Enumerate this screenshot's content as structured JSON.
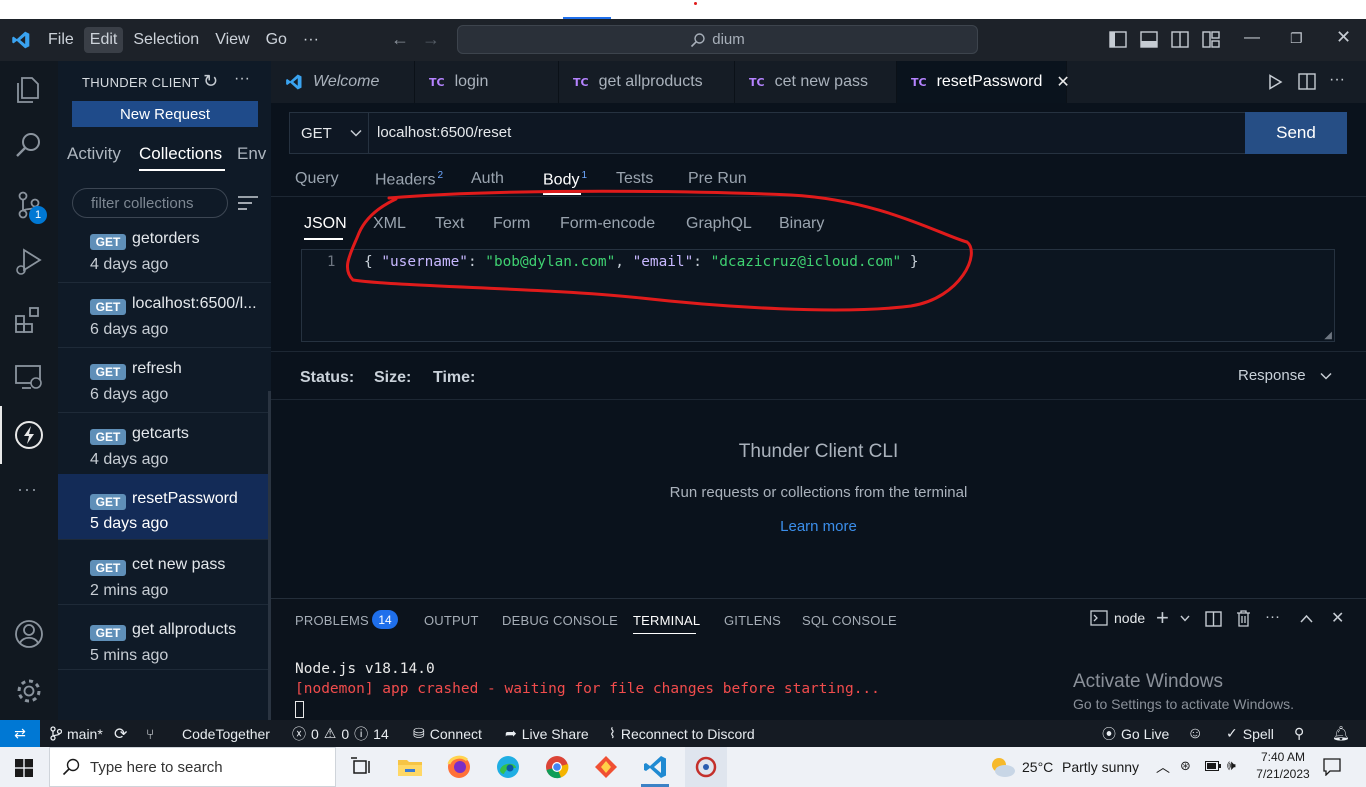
{
  "titlebar": {
    "menu": [
      "File",
      "Edit",
      "Selection",
      "View",
      "Go",
      "···"
    ],
    "active_menu": "Edit",
    "search_text": "dium"
  },
  "activity_bar": {
    "source_control_badge": "1"
  },
  "sidebar": {
    "title": "THUNDER CLIENT",
    "new_request": "New Request",
    "tabs": [
      "Activity",
      "Collections",
      "Env"
    ],
    "active_tab": "Collections",
    "filter_placeholder": "filter collections",
    "items": [
      {
        "method": "GET",
        "name": "getorders",
        "time": "4 days ago"
      },
      {
        "method": "GET",
        "name": "localhost:6500/l...",
        "time": "6 days ago"
      },
      {
        "method": "GET",
        "name": "refresh",
        "time": "6 days ago"
      },
      {
        "method": "GET",
        "name": "getcarts",
        "time": "4 days ago"
      },
      {
        "method": "GET",
        "name": "resetPassword",
        "time": "5 days ago"
      },
      {
        "method": "GET",
        "name": "cet new pass",
        "time": "2 mins ago"
      },
      {
        "method": "GET",
        "name": "get allproducts",
        "time": "5 mins ago"
      }
    ]
  },
  "tabs": [
    {
      "label": "Welcome",
      "kind": "vscode"
    },
    {
      "label": "login",
      "kind": "TC"
    },
    {
      "label": "get allproducts",
      "kind": "TC"
    },
    {
      "label": "cet new pass",
      "kind": "TC"
    },
    {
      "label": "resetPassword",
      "kind": "TC"
    }
  ],
  "request": {
    "method": "GET",
    "url": "localhost:6500/reset",
    "send_label": "Send",
    "tabs": [
      "Query",
      "Headers",
      "Auth",
      "Body",
      "Tests",
      "Pre Run"
    ],
    "headers_count": "2",
    "body_count": "1",
    "body_types": [
      "JSON",
      "XML",
      "Text",
      "Form",
      "Form-encode",
      "GraphQL",
      "Binary"
    ],
    "line_number": "1",
    "body_code": {
      "open": "{ ",
      "key1": "\"username\"",
      "sep1": ": ",
      "val1": "\"bob@dylan.com\"",
      "comma": ", ",
      "key2": "\"email\"",
      "sep2": ": ",
      "val2": "\"dcazicruz@icloud.com\"",
      "close": " }"
    }
  },
  "response": {
    "status_label": "Status:",
    "size_label": "Size:",
    "time_label": "Time:",
    "response_dropdown": "Response",
    "cli_title": "Thunder Client CLI",
    "cli_desc": "Run requests or collections from the terminal",
    "learn_more": "Learn more"
  },
  "panel": {
    "tabs": [
      "PROBLEMS",
      "OUTPUT",
      "DEBUG CONSOLE",
      "TERMINAL",
      "GITLENS",
      "SQL CONSOLE"
    ],
    "problems_count": "14",
    "active_tab": "TERMINAL",
    "terminal_name": "node",
    "lines": [
      {
        "text": "Node.js v18.14.0",
        "color": "#e8e8e8"
      },
      {
        "text": "[nodemon] app crashed - waiting for file changes before starting...",
        "color": "#f14c4c"
      }
    ],
    "watermark_title": "Activate Windows",
    "watermark_sub": "Go to Settings to activate Windows."
  },
  "statusbar": {
    "branch": "main*",
    "codetogether": "CodeTogether",
    "errors": "0",
    "warnings": "0",
    "infos": "14",
    "connect": "Connect",
    "liveshare": "Live Share",
    "discord": "Reconnect to Discord",
    "golive": "Go Live",
    "spell": "Spell"
  },
  "taskbar": {
    "search_placeholder": "Type here to search",
    "weather_temp": "25°C",
    "weather_desc": "Partly sunny",
    "time": "7:40 AM",
    "date": "7/21/2023"
  },
  "colors": {
    "accent": "#0078d4",
    "json_key": "#c8b8ff",
    "json_string": "#3fd171",
    "json_punct": "#c9d1d9",
    "annotation": "#e01b1b"
  }
}
